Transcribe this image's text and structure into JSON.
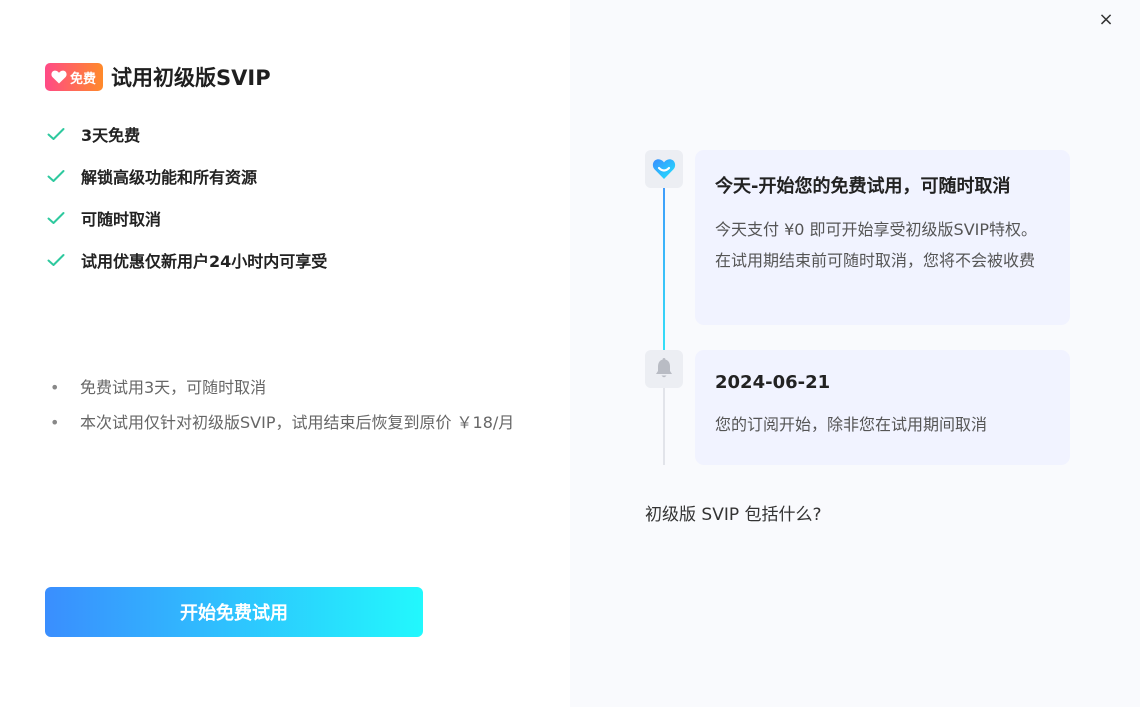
{
  "dialog": {
    "close_label": "×"
  },
  "header": {
    "badge_label": "免费",
    "title": "试用初级版SVIP"
  },
  "features": [
    "3天免费",
    "解锁高级功能和所有资源",
    "可随时取消",
    "试用优惠仅新用户24小时内可享受"
  ],
  "notes": [
    "免费试用3天，可随时取消",
    "本次试用仅针对初级版SVIP，试用结束后恢复到原价 ￥18/月"
  ],
  "cta_label": "开始免费试用",
  "timeline": [
    {
      "title": "今天-开始您的免费试用，可随时取消",
      "desc": "今天支付 ¥0 即可开始享受初级版SVIP特权。在试用期结束前可随时取消，您将不会被收费"
    },
    {
      "title": "2024-06-21",
      "desc": "您的订阅开始，除非您在试用期间取消"
    }
  ],
  "includes_link": "初级版 SVIP 包括什么?",
  "colors": {
    "accent_start": "#3a8efe",
    "accent_end": "#22f8fd",
    "check_green": "#2ec99e",
    "badge_start": "#ff4a87",
    "badge_end": "#ff8a2a",
    "card_bg": "#f1f3ff"
  },
  "icons": {
    "close": "close-icon",
    "badge": "heart-icon",
    "check": "check-icon",
    "timeline_start": "heart-logo-icon",
    "timeline_end": "bell-icon"
  }
}
